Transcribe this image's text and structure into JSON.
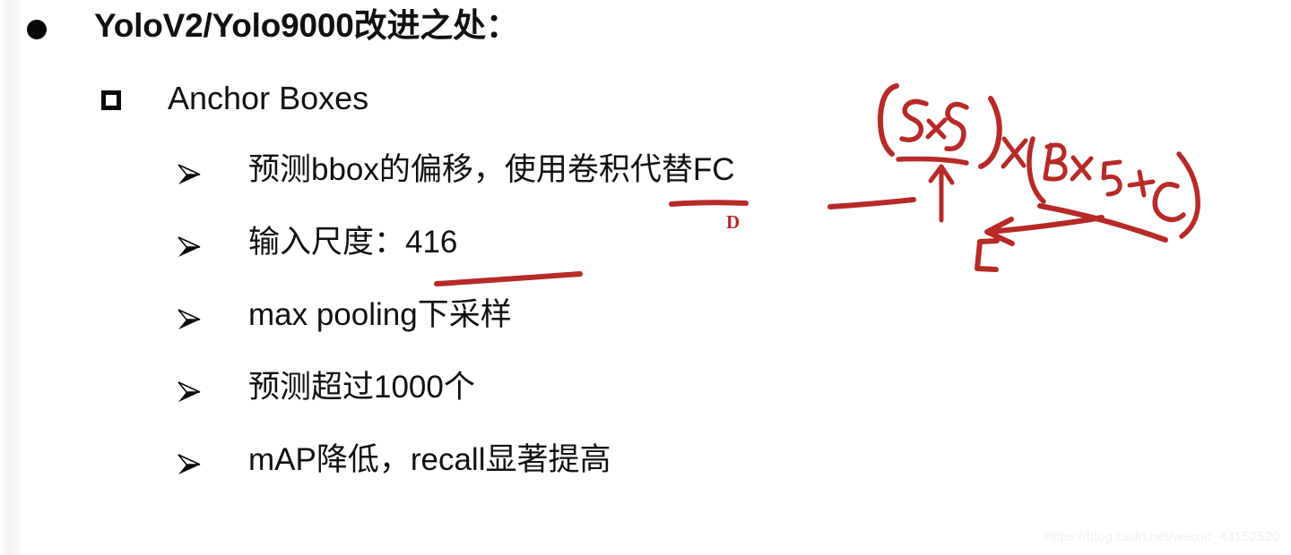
{
  "slide": {
    "background_color": "#ffffff",
    "title": {
      "bullet": "disc-bullet",
      "text": "YoloV2/Yolo9000改进之处："
    },
    "subheading": {
      "bullet": "square-bullet",
      "text": "Anchor Boxes"
    },
    "items": [
      {
        "bullet": "arrow-bullet",
        "text": "预测bbox的偏移，使用卷积代替FC"
      },
      {
        "bullet": "arrow-bullet",
        "text": "输入尺度：416"
      },
      {
        "bullet": "arrow-bullet",
        "text": "max pooling下采样"
      },
      {
        "bullet": "arrow-bullet",
        "text": "预测超过1000个"
      },
      {
        "bullet": "arrow-bullet",
        "text": "mAP降低，recall显著提高"
      }
    ]
  },
  "annotations": {
    "ink_color": "#b62a28",
    "formula": "(SxS)x(Bx5+C)",
    "formula_parts": {
      "grid_term": "(SxS)",
      "multiply": "x",
      "box_term": "(Bx5+C)"
    },
    "label_d": "D",
    "label_c": "C",
    "underlines": [
      {
        "target": "卷积"
      },
      {
        "target": "FC"
      },
      {
        "target": "416"
      }
    ],
    "arrows": [
      {
        "direction": "up",
        "points_to": "卷积-underline"
      },
      {
        "direction": "left",
        "points_to": "C-label"
      }
    ]
  },
  "watermark": {
    "text": "https://blog.csdn.net/weixin_43152520",
    "color": "#f0f0f0"
  }
}
